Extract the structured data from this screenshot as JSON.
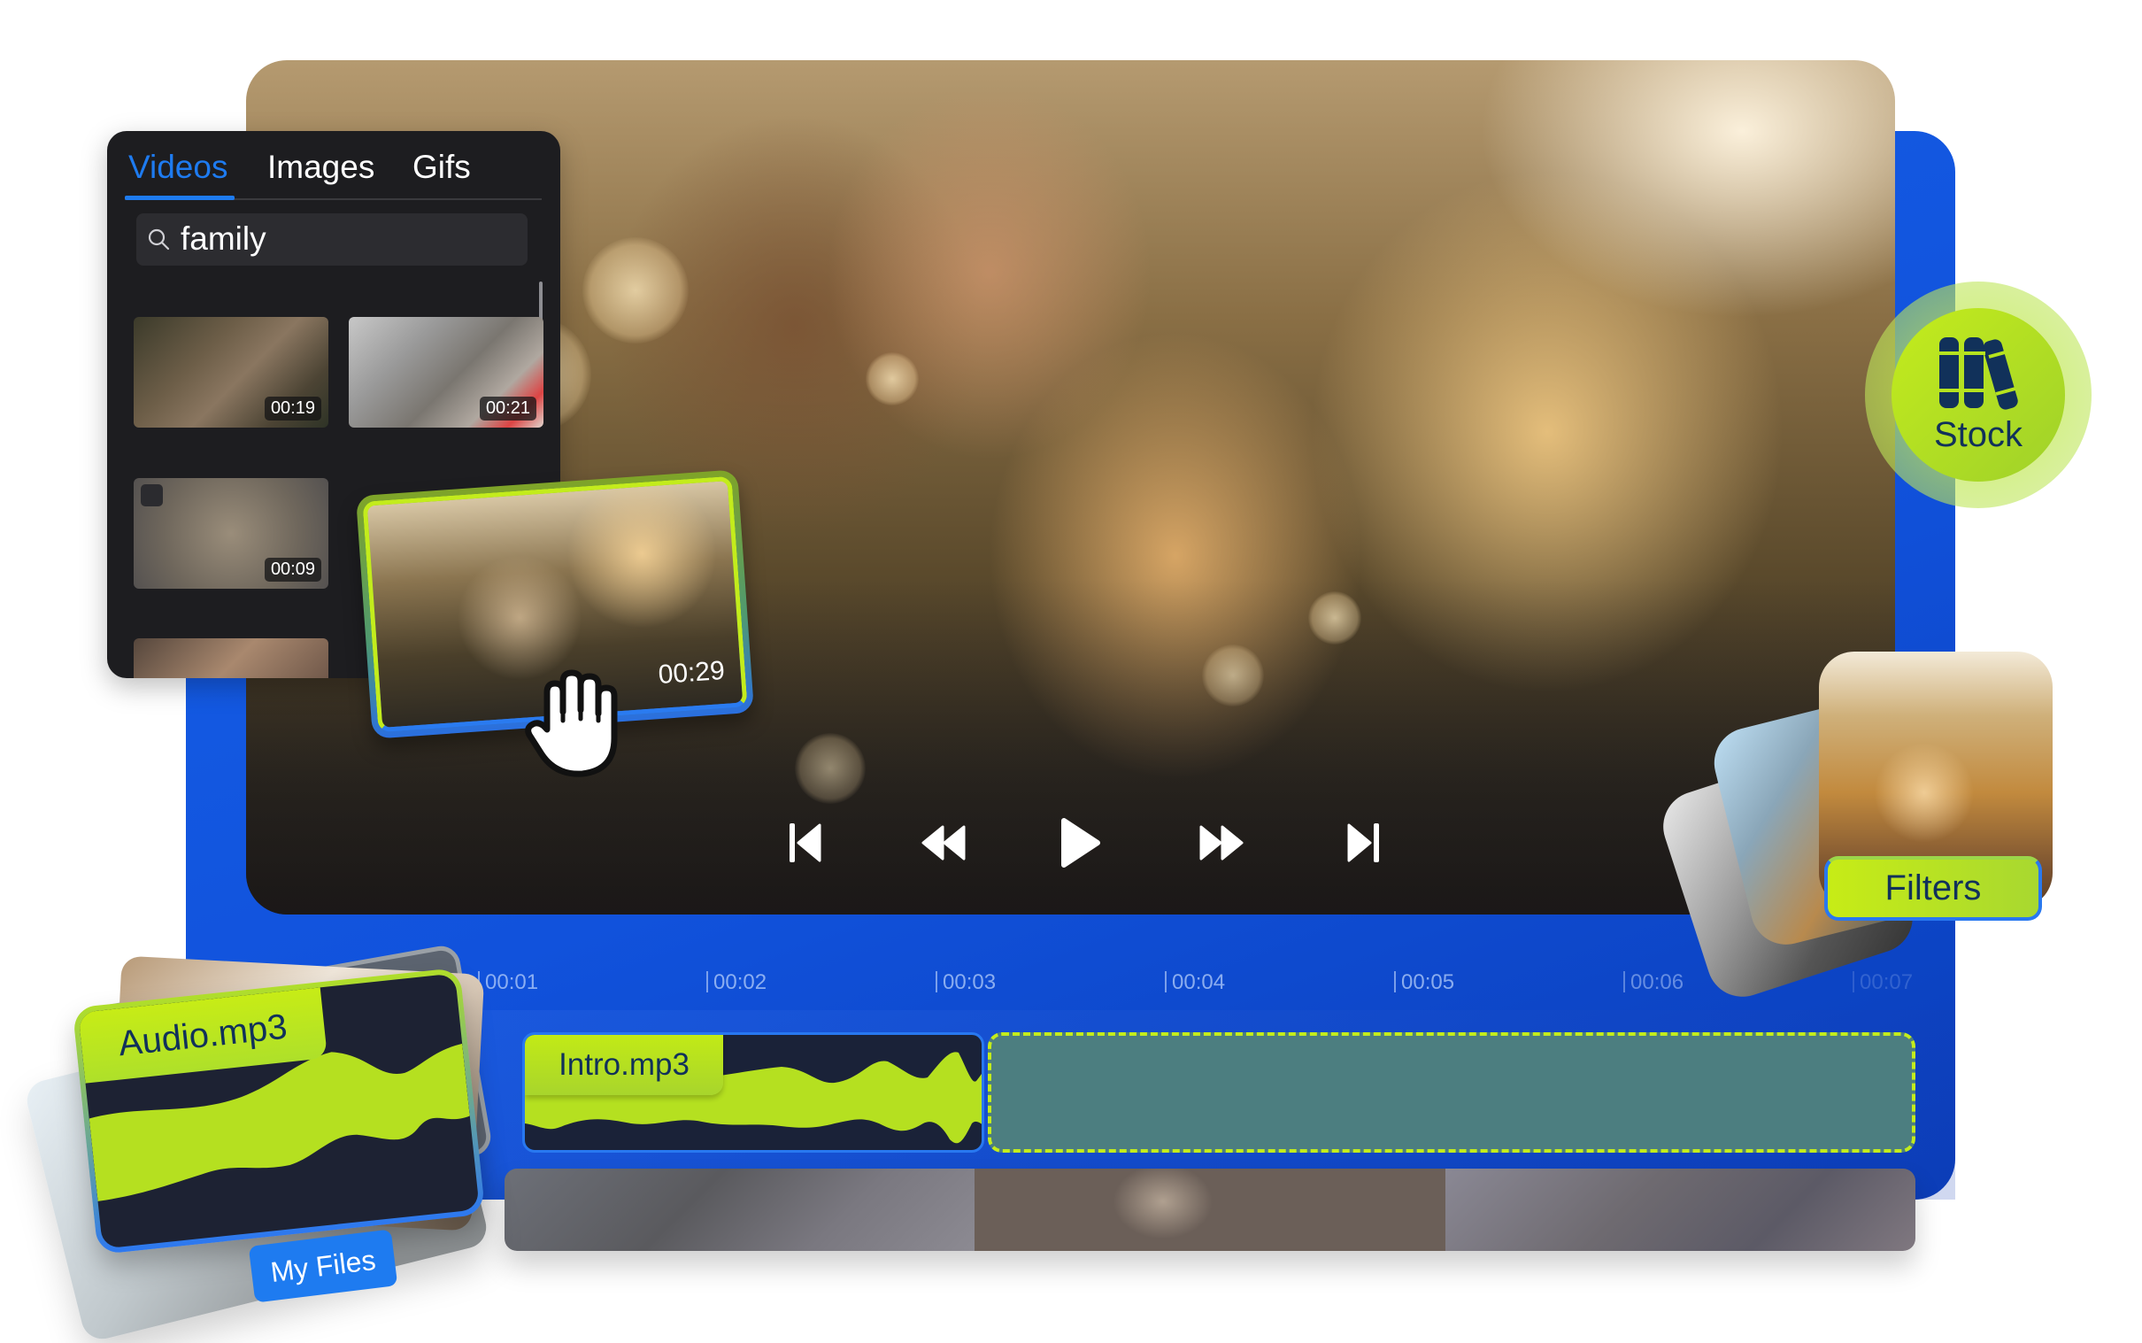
{
  "media_panel": {
    "tabs": [
      {
        "label": "Videos",
        "active": true
      },
      {
        "label": "Images",
        "active": false
      },
      {
        "label": "Gifs",
        "active": false
      }
    ],
    "search": {
      "value": "family",
      "icon": "search-icon"
    },
    "results": [
      {
        "duration": "00:19"
      },
      {
        "duration": "00:21"
      },
      {
        "duration": "00:09"
      }
    ]
  },
  "dragged_clip": {
    "duration": "00:29",
    "cursor": "grab-hand-icon"
  },
  "player": {
    "controls": [
      "skip-back-icon",
      "rewind-icon",
      "play-icon",
      "fast-forward-icon",
      "skip-forward-icon"
    ]
  },
  "stock_badge": {
    "label": "Stock",
    "icon": "books-icon"
  },
  "filters": {
    "label": "Filters"
  },
  "timeline": {
    "ticks": [
      "00:01",
      "00:02",
      "00:03",
      "00:04",
      "00:05",
      "00:06",
      "00:07"
    ]
  },
  "audio_track": {
    "clip_label": "Intro.mp3"
  },
  "my_files": {
    "card_label": "Audio.mp3",
    "button_label": "My Files"
  },
  "colors": {
    "accent_blue": "#1e7bf0",
    "backdrop_blue": "#1152dc",
    "lime": "#c3ec1c",
    "navy_text": "#11315a",
    "panel_bg": "#1d1d20"
  }
}
